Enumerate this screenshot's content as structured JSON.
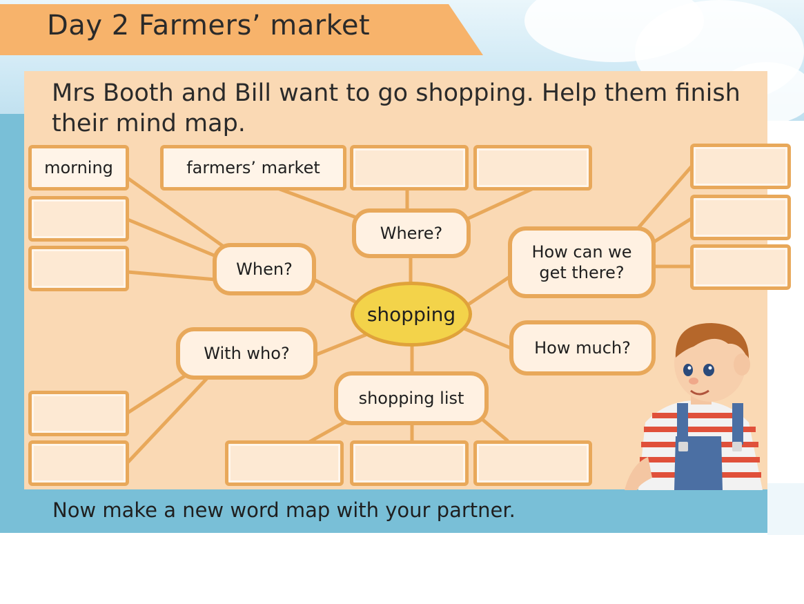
{
  "header": {
    "title": "Day 2  Farmers’ market"
  },
  "instructions": "Mrs Booth and Bill want to go shopping. Help them finish their mind map.",
  "mind_map": {
    "center": "shopping",
    "questions": {
      "when": "When?",
      "where": "Where?",
      "how_get": "How can we get there?",
      "with_who": "With who?",
      "how_much": "How much?",
      "shopping_list": "shopping list"
    },
    "answers": {
      "when_1": "morning",
      "where_1": "farmers’ market"
    }
  },
  "footer": "Now make a new word map with your partner.",
  "colors": {
    "panel": "#fad9b4",
    "border": "#e8a85a",
    "banner": "#f7b36b",
    "center": "#f3d34a",
    "band": "#79bfd7"
  }
}
